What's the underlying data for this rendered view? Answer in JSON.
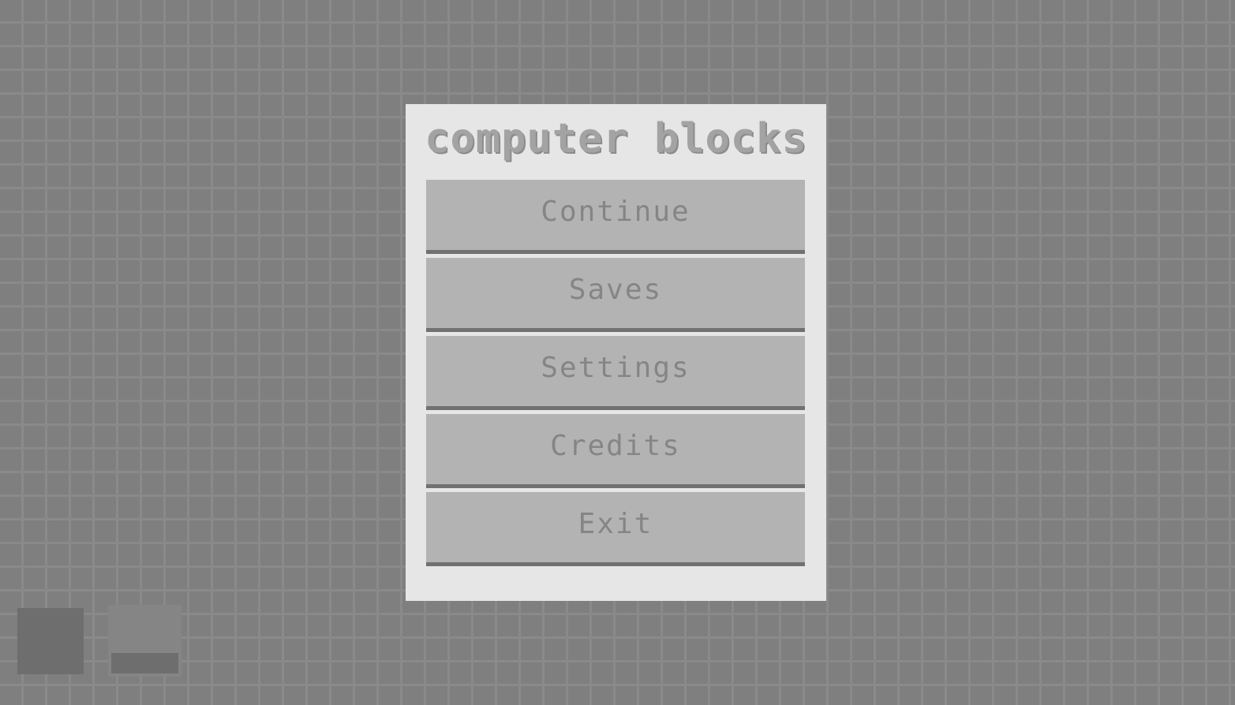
{
  "game": {
    "title": "computer blocks"
  },
  "menu": {
    "buttons": [
      {
        "label": "Continue"
      },
      {
        "label": "Saves"
      },
      {
        "label": "Settings"
      },
      {
        "label": "Credits"
      },
      {
        "label": "Exit"
      }
    ]
  },
  "colors": {
    "background": "#7f7f7f",
    "grid_line": "#8a8a8a",
    "panel": "#e6e6e6",
    "button": "#b3b3b3",
    "button_shadow": "#717171",
    "button_text": "#858585",
    "title_text": "#a3a3a3"
  }
}
